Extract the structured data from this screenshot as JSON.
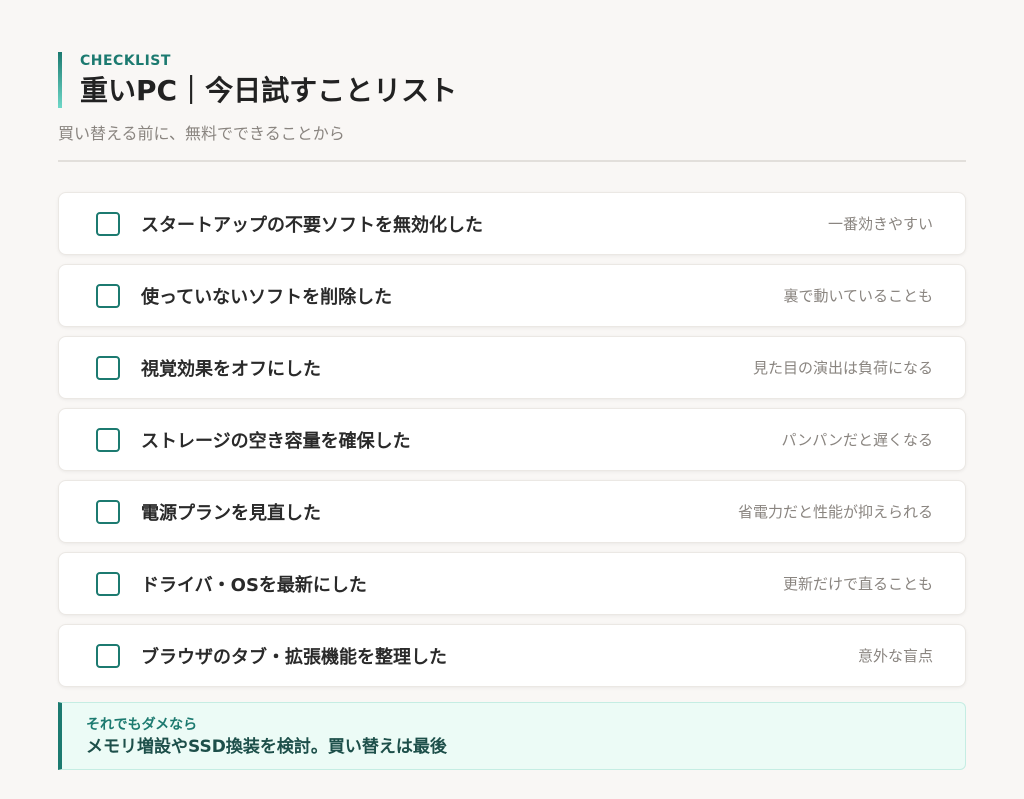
{
  "header": {
    "eyebrow": "CHECKLIST",
    "title": "重いPC｜今日試すことリスト",
    "subtitle": "買い替える前に、無料でできることから"
  },
  "colors": {
    "accent": "#1c7a70",
    "callout_bg": "#ecfbf6"
  },
  "items": [
    {
      "label": "スタートアップの不要ソフトを無効化した",
      "note": "一番効きやすい",
      "checked": false
    },
    {
      "label": "使っていないソフトを削除した",
      "note": "裏で動いていることも",
      "checked": false
    },
    {
      "label": "視覚効果をオフにした",
      "note": "見た目の演出は負荷になる",
      "checked": false
    },
    {
      "label": "ストレージの空き容量を確保した",
      "note": "パンパンだと遅くなる",
      "checked": false
    },
    {
      "label": "電源プランを見直した",
      "note": "省電力だと性能が抑えられる",
      "checked": false
    },
    {
      "label": "ドライバ・OSを最新にした",
      "note": "更新だけで直ることも",
      "checked": false
    },
    {
      "label": "ブラウザのタブ・拡張機能を整理した",
      "note": "意外な盲点",
      "checked": false
    }
  ],
  "callout": {
    "title": "それでもダメなら",
    "body": "メモリ増設やSSD換装を検討。買い替えは最後"
  }
}
